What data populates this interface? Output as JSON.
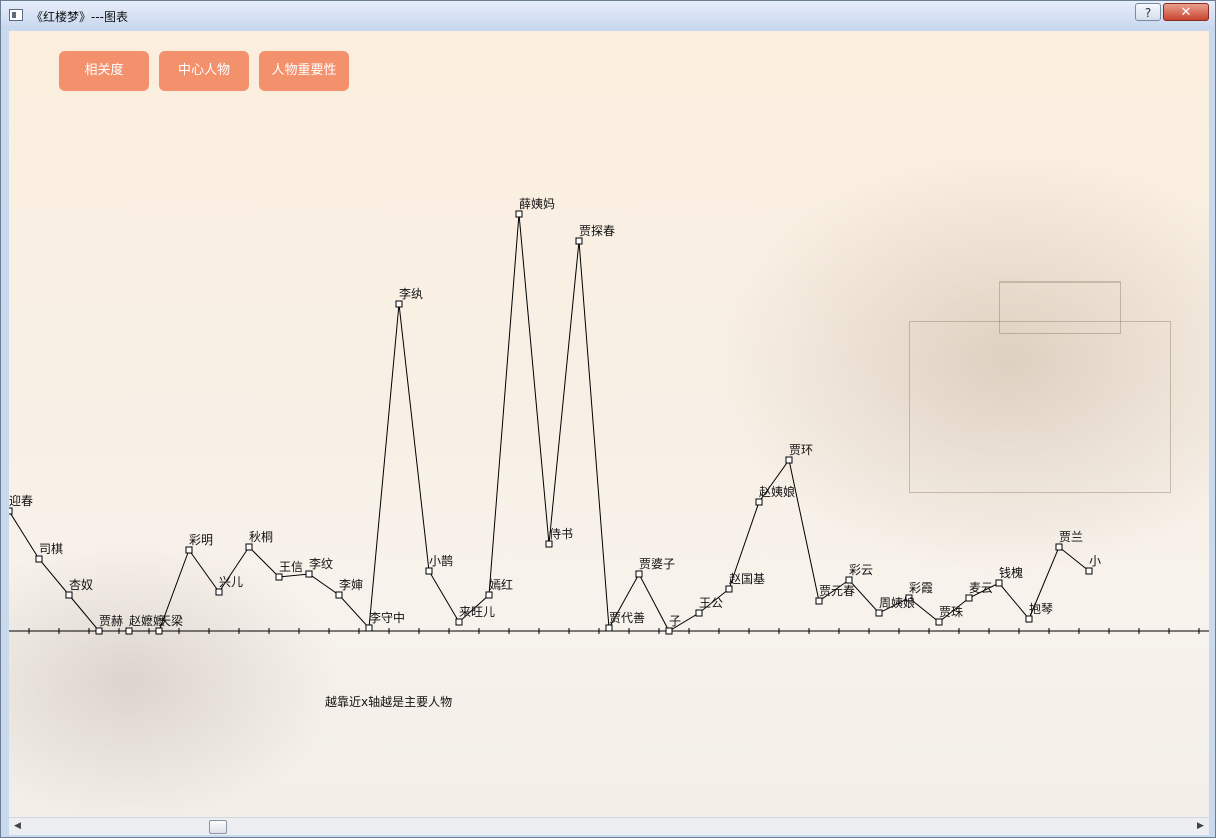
{
  "window": {
    "title": "《红楼梦》---图表",
    "help_label": "?",
    "close_label": "✕"
  },
  "toolbar": {
    "buttons": [
      "相关度",
      "中心人物",
      "人物重要性"
    ]
  },
  "note": "越靠近x轴越是主要人物",
  "colors": {
    "button": "#f4916d",
    "line": "#000000"
  },
  "chart_data": {
    "type": "line",
    "categories": [
      "迎春",
      "司棋",
      "杏奴",
      "贾赫",
      "赵嬷嬷",
      "天梁",
      "彩明",
      "兴儿",
      "秋桐",
      "王信",
      "李纹",
      "李婶",
      "李守中",
      "李纨",
      "小鹊",
      "来旺儿",
      "嫣红",
      "薛姨妈",
      "侍书",
      "贾探春",
      "贾代善",
      "贾婆子",
      "子",
      "王公",
      "赵国基",
      "赵姨娘",
      "贾环",
      "贾元春",
      "彩云",
      "周姨娘",
      "彩霞",
      "贾珠",
      "麦云",
      "钱槐",
      "抱琴",
      "贾兰",
      "小"
    ],
    "values": [
      40,
      24,
      12,
      0,
      0,
      0,
      27,
      13,
      28,
      18,
      19,
      12,
      1,
      109,
      20,
      3,
      12,
      139,
      29,
      130,
      1,
      19,
      0,
      6,
      14,
      43,
      57,
      10,
      17,
      6,
      11,
      3,
      11,
      16,
      4,
      28,
      20
    ]
  }
}
